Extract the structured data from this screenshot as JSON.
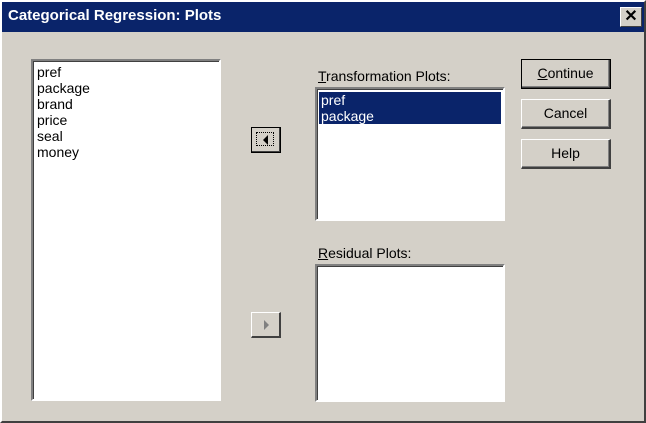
{
  "window": {
    "title": "Categorical Regression: Plots",
    "close_glyph": "✕"
  },
  "source_list": {
    "items": [
      "pref",
      "package",
      "brand",
      "price",
      "seal",
      "money"
    ]
  },
  "transformation": {
    "label_prefix": "",
    "label_mnemonic": "T",
    "label_rest": "ransformation Plots:",
    "items": [
      "pref",
      "package"
    ]
  },
  "residual": {
    "label_mnemonic": "R",
    "label_rest": "esidual Plots:",
    "items": []
  },
  "buttons": {
    "continue_mnemonic": "C",
    "continue_rest": "ontinue",
    "cancel": "Cancel",
    "help": "Help"
  },
  "icons": {
    "move_left": "arrow-left-icon",
    "move_right": "arrow-right-icon"
  },
  "colors": {
    "title_bar": "#0a246a",
    "selection": "#0a246a",
    "face": "#d4d0c8"
  }
}
